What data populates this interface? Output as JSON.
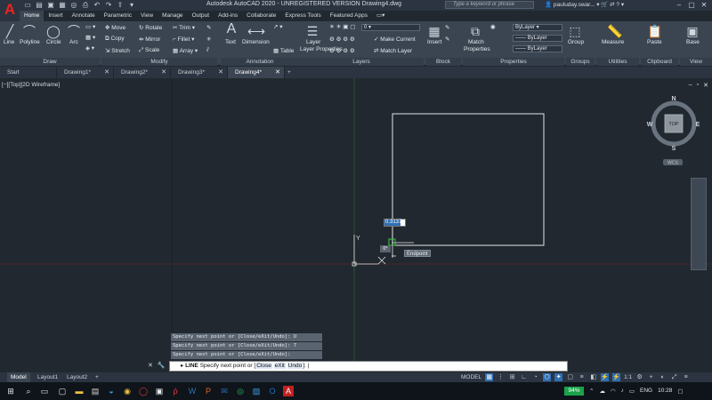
{
  "titlebar": {
    "title": "Autodesk AutoCAD 2020 - UNREGISTERED VERSION    Drawing4.dwg",
    "search_placeholder": "Type a keyword or phrase",
    "user": "pauluday.swar...",
    "app_letter": "A"
  },
  "ribbon_tabs": [
    "Home",
    "Insert",
    "Annotate",
    "Parametric",
    "View",
    "Manage",
    "Output",
    "Add-ins",
    "Collaborate",
    "Express Tools",
    "Featured Apps"
  ],
  "ribbon": {
    "draw": {
      "title": "Draw",
      "line": "Line",
      "polyline": "Polyline",
      "circle": "Circle",
      "arc": "Arc"
    },
    "modify": {
      "title": "Modify",
      "move": "Move",
      "rotate": "Rotate",
      "trim": "Trim",
      "copy": "Copy",
      "mirror": "Mirror",
      "fillet": "Fillet",
      "stretch": "Stretch",
      "scale": "Scale",
      "array": "Array"
    },
    "annotation": {
      "title": "Annotation",
      "text": "Text",
      "dimension": "Dimension",
      "table": "Table"
    },
    "layers": {
      "title": "Layers",
      "layer_properties": "Layer Properties",
      "layer_value": "0",
      "make_current": "Make Current",
      "match_layer": "Match Layer"
    },
    "block": {
      "title": "Block",
      "insert": "Insert"
    },
    "properties": {
      "title": "Properties",
      "match": "Match Properties",
      "bylayer1": "ByLayer",
      "bylayer2": "ByLayer",
      "bylayer3": "ByLayer"
    },
    "groups": {
      "title": "Groups",
      "group": "Group"
    },
    "utilities": {
      "title": "Utilities",
      "measure": "Measure"
    },
    "clipboard": {
      "title": "Clipboard",
      "paste": "Paste"
    },
    "view": {
      "title": "View",
      "base": "Base"
    }
  },
  "doc_tabs": [
    "Start",
    "Drawing1*",
    "Drawing2*",
    "Drawing3*",
    "Drawing4*"
  ],
  "viewport": {
    "label": "[−][Top][2D Wireframe]",
    "compass": {
      "n": "N",
      "s": "S",
      "e": "E",
      "w": "W",
      "top": "TOP",
      "wcs": "WCS"
    },
    "dynamic_input_value": "0.3137",
    "snap_tooltip": "Endpoint",
    "angle_value": "0°",
    "y_axis": "Y"
  },
  "command": {
    "history": [
      "Specify next point or [Close/eXit/Undo]: U",
      "Specify next point or [Close/eXit/Undo]: 7",
      "Specify next point or [Close/eXit/Undo]:"
    ],
    "prompt_cmd": "LINE",
    "prompt_text": "Specify next point or [",
    "kw_close": "Close",
    "kw_exit": "eXit",
    "kw_undo": "Undo",
    "prompt_end": "]:"
  },
  "layout_tabs": [
    "Model",
    "Layout1",
    "Layout2"
  ],
  "status": {
    "model": "MODEL",
    "scale": "1:1"
  },
  "taskbar": {
    "battery": "94%",
    "lang": "ENG",
    "time": "10:28"
  },
  "colors": {
    "background": "#212830",
    "ribbon": "#3b4552",
    "accent": "#2f6fb3",
    "ucs_green": "#3a8a3a",
    "ucs_red": "#8a3a3a"
  }
}
